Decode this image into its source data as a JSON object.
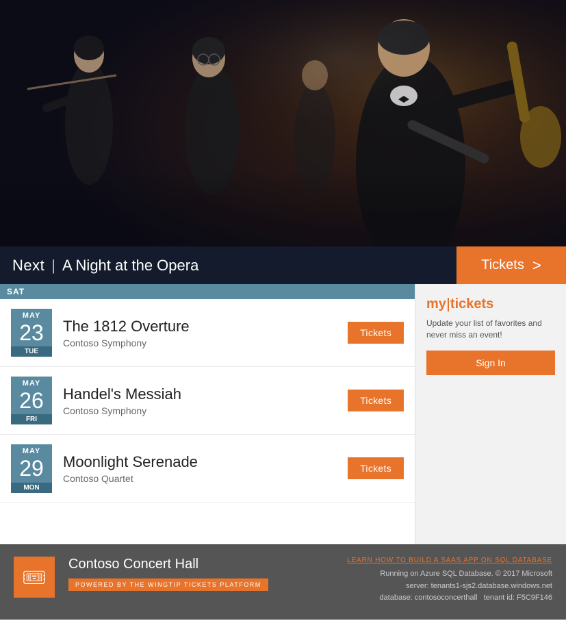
{
  "hero": {
    "next_label": "Next",
    "divider": "|",
    "event_title": "A Night at the Opera",
    "tickets_label": "Tickets",
    "chevron": ">"
  },
  "events": {
    "date_header": "SAT",
    "items": [
      {
        "month": "MAY",
        "day": "23",
        "dow": "TUE",
        "name": "The 1812 Overture",
        "venue": "Contoso Symphony",
        "tickets_label": "Tickets"
      },
      {
        "month": "MAY",
        "day": "26",
        "dow": "FRI",
        "name": "Handel's Messiah",
        "venue": "Contoso Symphony",
        "tickets_label": "Tickets"
      },
      {
        "month": "MAY",
        "day": "29",
        "dow": "MON",
        "name": "Moonlight Serenade",
        "venue": "Contoso Quartet",
        "tickets_label": "Tickets"
      }
    ]
  },
  "sidebar": {
    "title_prefix": "my",
    "title_suffix": "tickets",
    "description": "Update your list of favorites and never miss an event!",
    "signin_label": "Sign In"
  },
  "footer": {
    "brand_name": "Contoso Concert Hall",
    "powered_text": "POWERED BY THE WINGTIP TICKETS PLATFORM",
    "saas_link": "LEARN HOW TO BUILD A SAAS APP ON SQL DATABASE",
    "info_line1": "Running on Azure SQL Database. © 2017 Microsoft",
    "info_line2": "server: tenants1-sjs2.database.windows.net",
    "info_line3_prefix": "database: contosoconcerthall",
    "info_line3_suffix": "tenant id: F5C9F146"
  }
}
